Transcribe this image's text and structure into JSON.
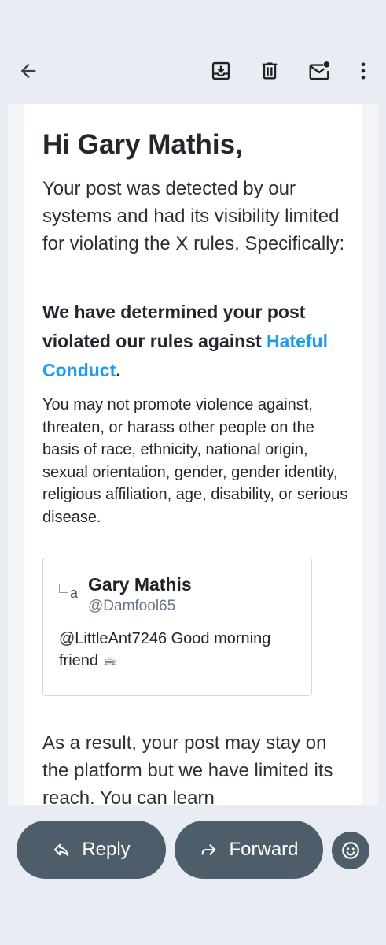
{
  "toolbar": {
    "back_icon": "arrow-left-icon",
    "archive_icon": "archive-icon",
    "delete_icon": "trash-icon",
    "mark_unread_icon": "mail-unread-icon",
    "more_icon": "more-vert-icon"
  },
  "email": {
    "greeting": "Hi Gary Mathis,",
    "intro": "Your post was detected by our systems and had its visibility limited for violating the X rules. Specifically:",
    "determined_prefix": "We have determined your post violated our rules against ",
    "determined_link": "Hateful Conduct",
    "determined_suffix": ".",
    "policy": "You may not promote violence against, threaten, or harass other people on the basis of race, ethnicity, national origin, sexual orientation, gender, gender identity, religious affiliation, age, disability, or serious disease.",
    "tweet": {
      "avatar_alt": "a",
      "name": "Gary Mathis",
      "handle": "@Damfool65",
      "text": "@LittleAnt7246 Good morning friend ☕"
    },
    "result": "As a result, your post may stay on the platform but we have limited its reach. You can learn"
  },
  "actions": {
    "reply_label": "Reply",
    "forward_label": "Forward",
    "reply_icon": "reply-arrow-icon",
    "forward_icon": "forward-arrow-icon",
    "emoji_icon": "emoji-smile-icon"
  },
  "colors": {
    "background": "#e9ecf3",
    "link": "#1d9bf0",
    "pill": "#4d5d6a"
  }
}
